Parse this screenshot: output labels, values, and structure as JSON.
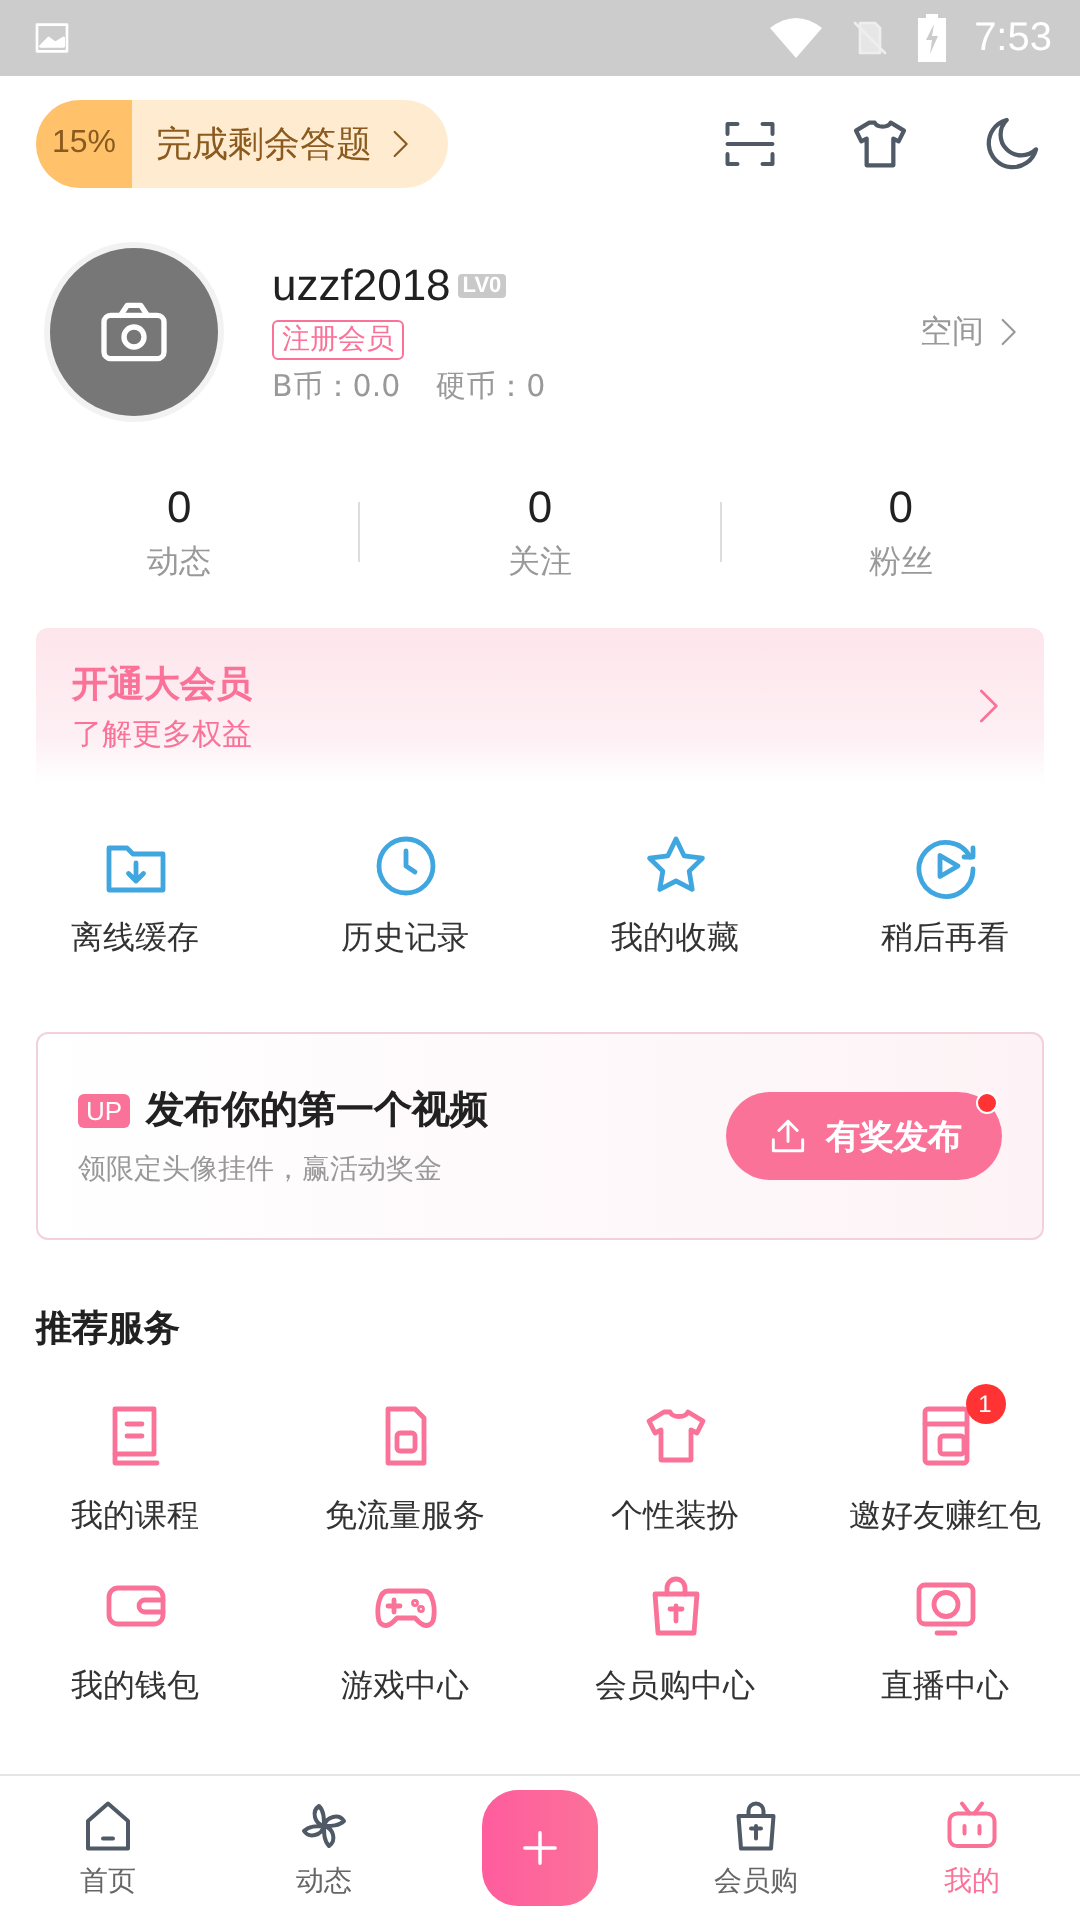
{
  "status_bar": {
    "time": "7:53"
  },
  "quiz": {
    "percent": "15%",
    "label": "完成剩余答题"
  },
  "profile": {
    "username": "uzzf2018",
    "level_badge": "LV0",
    "member_tag": "注册会员",
    "b_coins": "B币：0.0",
    "coins": "硬币：0",
    "space_link": "空间"
  },
  "stats": [
    {
      "value": "0",
      "label": "动态"
    },
    {
      "value": "0",
      "label": "关注"
    },
    {
      "value": "0",
      "label": "粉丝"
    }
  ],
  "vip_banner": {
    "title": "开通大会员",
    "subtitle": "了解更多权益"
  },
  "quick_actions": [
    {
      "label": "离线缓存"
    },
    {
      "label": "历史记录"
    },
    {
      "label": "我的收藏"
    },
    {
      "label": "稍后再看"
    }
  ],
  "upload_card": {
    "badge": "UP",
    "title": "发布你的第一个视频",
    "subtitle": "领限定头像挂件，赢活动奖金",
    "button": "有奖发布",
    "notified": true
  },
  "services": {
    "title": "推荐服务",
    "items": [
      {
        "label": "我的课程"
      },
      {
        "label": "免流量服务"
      },
      {
        "label": "个性装扮"
      },
      {
        "label": "邀好友赚红包",
        "badge": "1"
      },
      {
        "label": "我的钱包"
      },
      {
        "label": "游戏中心"
      },
      {
        "label": "会员购中心"
      },
      {
        "label": "直播中心"
      }
    ]
  },
  "bottom_nav": [
    {
      "kind": "tab",
      "label": "首页",
      "selected": false
    },
    {
      "kind": "tab",
      "label": "动态",
      "selected": false
    },
    {
      "kind": "add"
    },
    {
      "kind": "tab",
      "label": "会员购",
      "selected": false
    },
    {
      "kind": "tab",
      "label": "我的",
      "selected": true
    }
  ]
}
